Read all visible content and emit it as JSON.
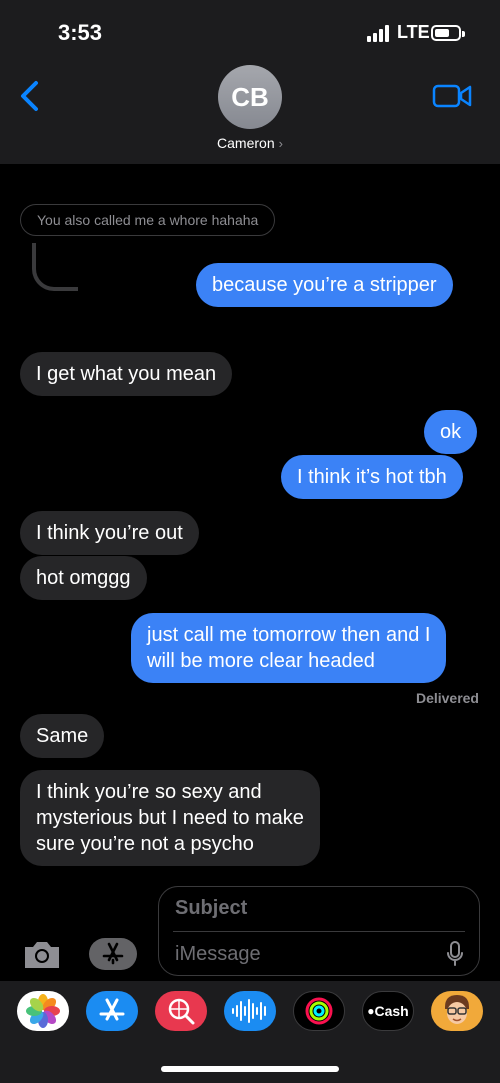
{
  "status_bar": {
    "time": "3:53",
    "network": "LTE"
  },
  "header": {
    "avatar_initials": "CB",
    "contact_name": "Cameron",
    "chevron": "›"
  },
  "messages": {
    "quote": "You also called me a whore hahaha",
    "m1": "because you’re a stripper",
    "m2": "I get what you mean",
    "m3": "ok",
    "m4": "I think it’s hot tbh",
    "m5": "I think you’re out",
    "m6": "hot omggg",
    "m7_line1": "just call me tomorrow then and I",
    "m7_line2": "will be more clear headed",
    "delivered": "Delivered",
    "m8": "Same",
    "m9_line1": "I think you’re so sexy and",
    "m9_line2": "mysterious but I need to make",
    "m9_line3": "sure you’re not a psycho"
  },
  "compose": {
    "subject_placeholder": "Subject",
    "message_placeholder": "iMessage"
  },
  "drawer": {
    "apps": [
      "photos-icon",
      "app-store-icon",
      "web-search-icon",
      "audio-message-icon",
      "activity-icon",
      "apple-cash-icon",
      "memoji-icon"
    ],
    "cash_label": "Cash"
  },
  "colors": {
    "outgoing_bubble": "#3b82f6",
    "incoming_bubble": "#262628",
    "accent": "#0a84ff",
    "background": "#000000"
  }
}
